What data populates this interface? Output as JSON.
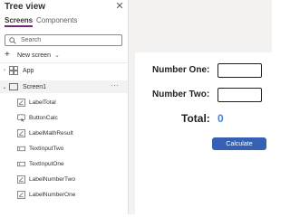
{
  "tree_view": {
    "title": "Tree view",
    "tabs": [
      {
        "label": "Screens",
        "active": true
      },
      {
        "label": "Components",
        "active": false
      }
    ],
    "search": {
      "placeholder": "Search",
      "value": ""
    },
    "new_screen_label": "New screen",
    "app_label": "App",
    "screen": {
      "label": "Screen1",
      "more_label": "···",
      "children": [
        {
          "label": "LabelTotal",
          "icon": "label-icon"
        },
        {
          "label": "ButtonCalc",
          "icon": "button-icon"
        },
        {
          "label": "LabelMathResult",
          "icon": "label-icon"
        },
        {
          "label": "TextInputTwo",
          "icon": "text-input-icon"
        },
        {
          "label": "TextInputOne",
          "icon": "text-input-icon"
        },
        {
          "label": "LabelNumberTwo",
          "icon": "label-icon"
        },
        {
          "label": "LabelNumberOne",
          "icon": "label-icon"
        }
      ]
    }
  },
  "canvas": {
    "number_one_label": "Number One:",
    "number_two_label": "Number Two:",
    "input_one_value": "",
    "input_two_value": "",
    "total_label": "Total:",
    "result_value": "0",
    "calculate_button_label": "Calculate"
  },
  "colors": {
    "accent": "#742774",
    "button": "#3860b2",
    "result": "#3b82f6",
    "canvas_background": "#f3f2f1"
  }
}
